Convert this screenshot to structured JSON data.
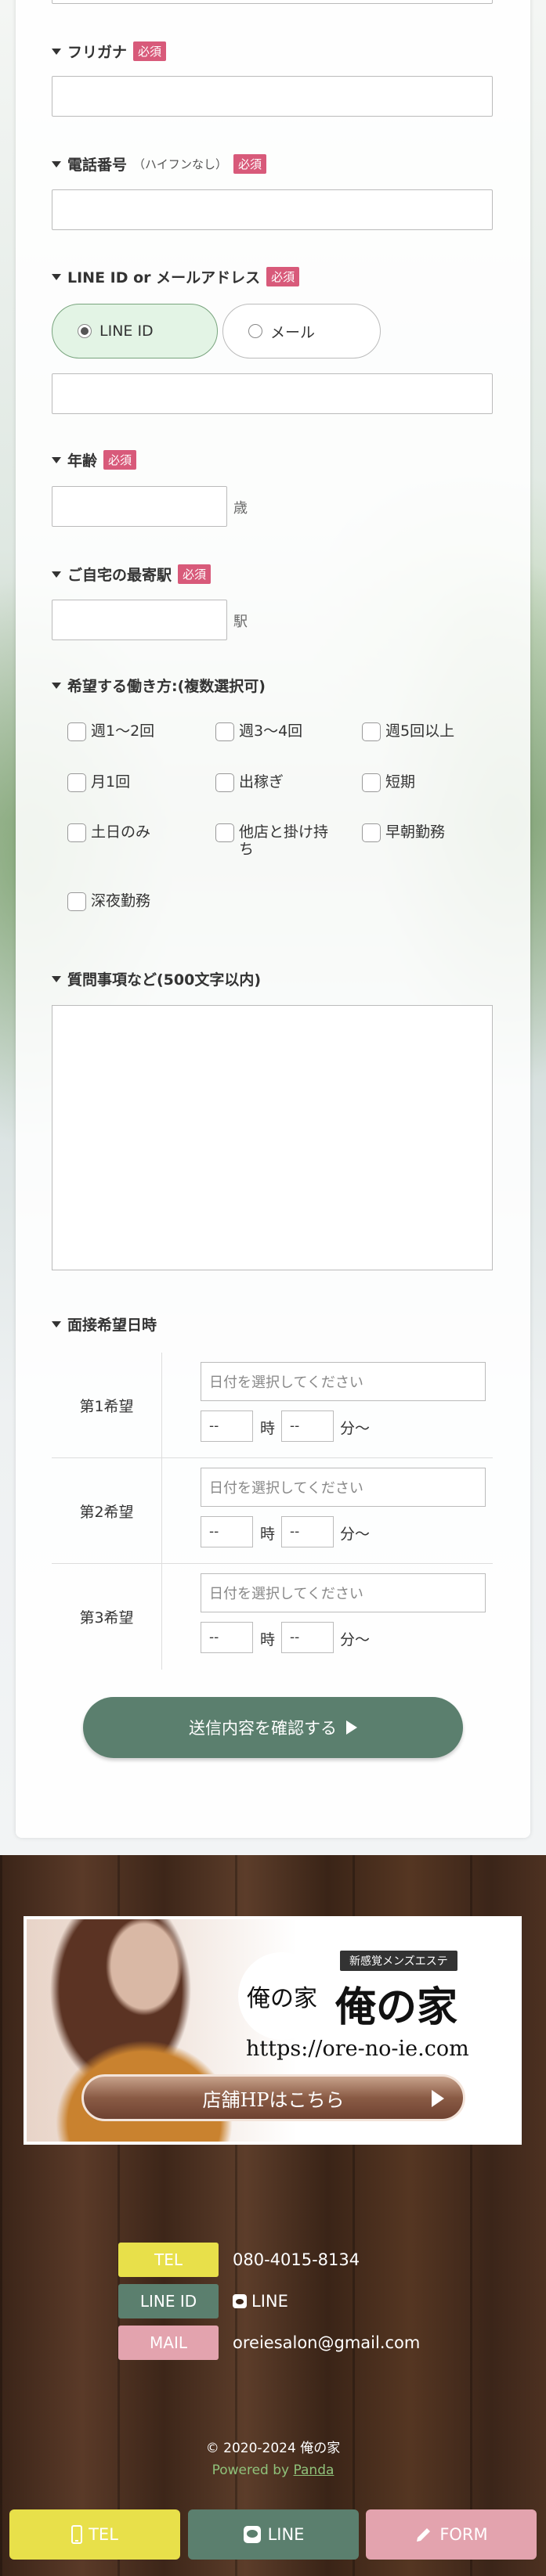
{
  "form": {
    "furigana": {
      "label": "フリガナ",
      "required": "必須"
    },
    "phone": {
      "label": "電話番号",
      "note": "（ハイフンなし）",
      "required": "必須"
    },
    "contact": {
      "label": "LINE ID or メールアドレス",
      "required": "必須",
      "options": [
        "LINE ID",
        "メール"
      ],
      "selected": "LINE ID"
    },
    "age": {
      "label": "年齢",
      "required": "必須",
      "unit": "歳"
    },
    "station": {
      "label": "ご自宅の最寄駅",
      "required": "必須",
      "unit": "駅"
    },
    "work_style": {
      "label": "希望する働き方:(複数選択可)",
      "options": [
        "週1〜2回",
        "週3〜4回",
        "週5回以上",
        "月1回",
        "出稼ぎ",
        "短期",
        "土日のみ",
        "他店と掛け持ち",
        "早朝勤務",
        "深夜勤務"
      ]
    },
    "questions": {
      "label": "質問事項など(500文字以内)"
    },
    "interview": {
      "label": "面接希望日時",
      "rows": [
        {
          "name": "第1希望",
          "date_placeholder": "日付を選択してください",
          "hour": "--",
          "min": "--",
          "hour_label": "時",
          "min_label": "分〜"
        },
        {
          "name": "第2希望",
          "date_placeholder": "日付を選択してください",
          "hour": "--",
          "min": "--",
          "hour_label": "時",
          "min_label": "分〜"
        },
        {
          "name": "第3希望",
          "date_placeholder": "日付を選択してください",
          "hour": "--",
          "min": "--",
          "hour_label": "時",
          "min_label": "分〜"
        }
      ]
    },
    "submit_label": "送信内容を確認する"
  },
  "banner": {
    "logo_chars": "俺の家",
    "tag": "新感覚メンズエステ",
    "title": "俺の家",
    "url": "https://ore-no-ie.com",
    "button": "店舗HPはこちら"
  },
  "contacts": [
    {
      "tag": "TEL",
      "value": "080-4015-8134",
      "color": "#e8e04a"
    },
    {
      "tag": "LINE ID",
      "value": "LINE",
      "color": "#5b7f6e"
    },
    {
      "tag": "MAIL",
      "value": "oreiesalon@gmail.com",
      "color": "#e3a3ae"
    }
  ],
  "copyright": "©  2020-2024  俺の家",
  "powered_prefix": "Powered by ",
  "powered_link": "Panda",
  "bottom_bar": [
    {
      "label": "TEL",
      "icon": "phone-icon",
      "color": "#e8e04a"
    },
    {
      "label": "LINE",
      "icon": "line-icon",
      "color": "#5b7f6e"
    },
    {
      "label": "FORM",
      "icon": "pencil-icon",
      "color": "#e3a3ae"
    }
  ]
}
